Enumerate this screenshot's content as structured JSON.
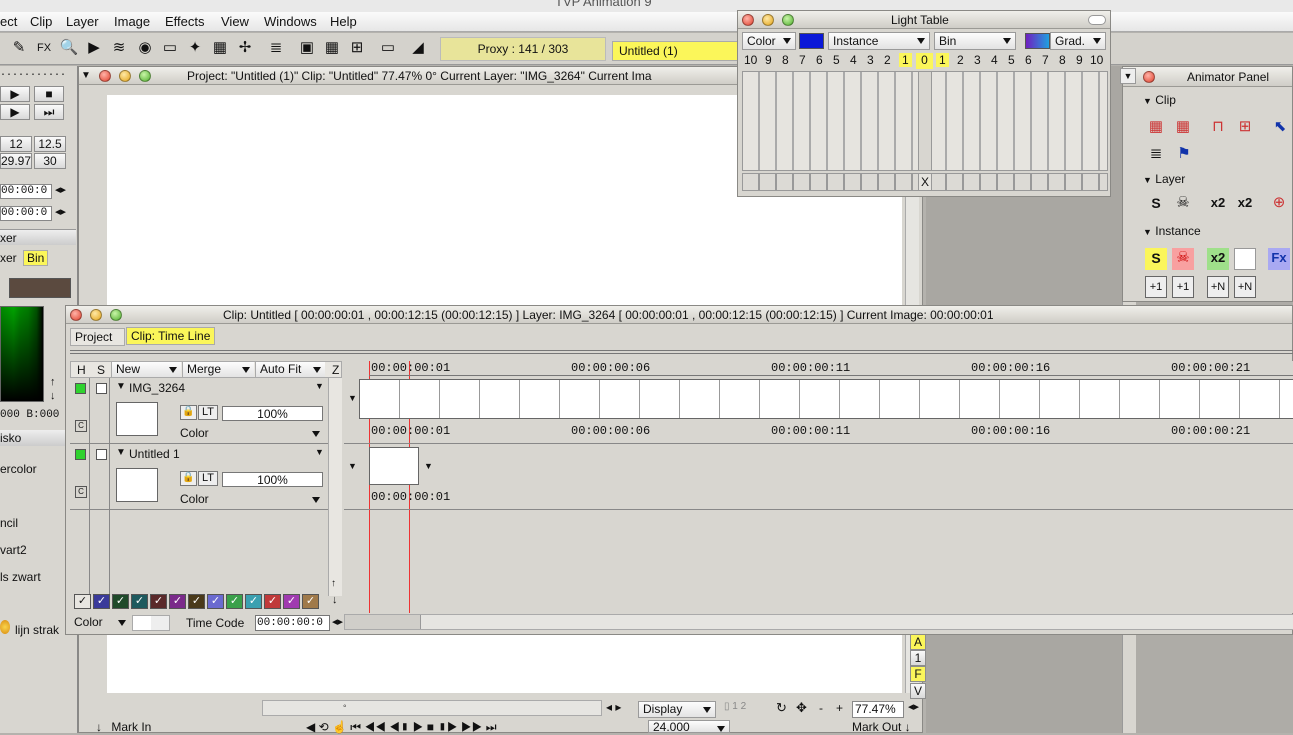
{
  "app_title": "TVP Animation 9",
  "menu": [
    "ect",
    "Clip",
    "Layer",
    "Image",
    "Effects",
    "View",
    "Windows",
    "Help"
  ],
  "toolbar": {
    "fx_label": "FX",
    "proxy_label": "Proxy : 141 / 303",
    "project_tab": "Untitled (1)"
  },
  "left_panel": {
    "fps_values": [
      "12",
      "12.5",
      "29.97",
      "30"
    ],
    "time1": "00:00:0",
    "time2": "00:00:0",
    "marker_title": "xer",
    "tabs": [
      "xer",
      "Bin"
    ],
    "color_readout": "000 B:000",
    "preset_title": "isko",
    "presets": [
      "ercolor",
      "ncil",
      "vart2",
      "ls zwart",
      "lijn strak"
    ]
  },
  "main_window": {
    "title": "Project:  \"Untitled (1)\"  Clip: \"Untitled\"   77.47%   0°  Current Layer: \"IMG_3264\"  Current Ima"
  },
  "light_table": {
    "title": "Light Table",
    "color_dd": "Color",
    "instance_dd": "Instance",
    "bin_dd": "Bin",
    "grad_dd": "Grad.",
    "left_nums": [
      "10",
      "9",
      "8",
      "7",
      "6",
      "5",
      "4",
      "3",
      "2",
      "1"
    ],
    "center": "0",
    "right_nums": [
      "1",
      "2",
      "3",
      "4",
      "5",
      "6",
      "7",
      "8",
      "9",
      "10"
    ],
    "x_label": "X",
    "accent_blue": "#0a18d8"
  },
  "animator": {
    "title": "Animator Panel",
    "sections": [
      "Clip",
      "Layer",
      "Instance"
    ],
    "layer_buttons": [
      "S",
      "x2",
      "x2"
    ],
    "instance_buttons": [
      "S",
      "x2",
      "Fx"
    ],
    "step_buttons": [
      "+1",
      "+1",
      "+N",
      "+N"
    ]
  },
  "timeline": {
    "title": "Clip: Untitled [ 00:00:00:01 , 00:00:12:15  (00:00:12:15) ]     Layer: IMG_3264 [ 00:00:00:01 , 00:00:12:15  (00:00:12:15) ]    Current Image: 00:00:00:01",
    "tabs": [
      "Project",
      "Clip: Time Line"
    ],
    "headers": {
      "h": "H",
      "s": "S",
      "new": "New",
      "merge": "Merge",
      "autofit": "Auto Fit",
      "z": "Z"
    },
    "ruler": [
      "00:00:00:01",
      "00:00:00:06",
      "00:00:00:11",
      "00:00:00:16",
      "00:00:00:21"
    ],
    "layers": [
      {
        "name": "IMG_3264",
        "opacity": "100%",
        "lock": "LT",
        "mode": "Color",
        "c": "C"
      },
      {
        "name": "Untitled 1",
        "opacity": "100%",
        "lock": "LT",
        "mode": "Color",
        "c": "C"
      }
    ],
    "layer2_time": "00:00:00:01",
    "bottom": {
      "color_dd": "Color",
      "timecode_label": "Time Code",
      "timecode_value": "00:00:00:0"
    },
    "swatches": [
      "#3a3a9a",
      "#1f4a2a",
      "#1e5a5e",
      "#5a2a2a",
      "#7a2a8a",
      "#4a3a1a",
      "#6a6ad0",
      "#3aa04a",
      "#3aa0b0",
      "#c03a3a",
      "#a03ab0",
      "#a07a4a"
    ]
  },
  "bottom_bar": {
    "display_dd": "Display",
    "zoom": "77.47%",
    "mark_in": "Mark In",
    "mark_out": "Mark Out",
    "fps": "24.000",
    "side_letters": [
      "A",
      "1",
      "F",
      "V"
    ]
  }
}
